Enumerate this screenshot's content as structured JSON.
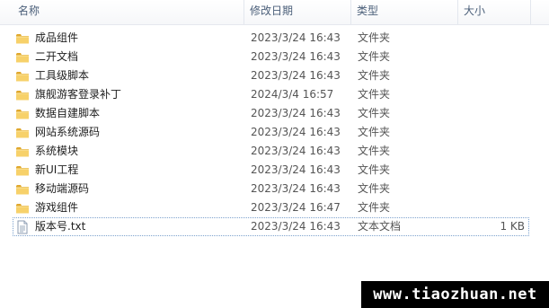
{
  "columns": {
    "name": "名称",
    "modified": "修改日期",
    "type": "类型",
    "size": "大小",
    "sort_indicator": "^"
  },
  "files": [
    {
      "name": "成品组件",
      "modified": "2023/3/24 16:43",
      "type": "文件夹",
      "size": "",
      "icon": "folder-icon"
    },
    {
      "name": "二开文档",
      "modified": "2023/3/24 16:43",
      "type": "文件夹",
      "size": "",
      "icon": "folder-icon"
    },
    {
      "name": "工具级脚本",
      "modified": "2023/3/24 16:43",
      "type": "文件夹",
      "size": "",
      "icon": "folder-icon"
    },
    {
      "name": "旗舰游客登录补丁",
      "modified": "2024/3/4 16:57",
      "type": "文件夹",
      "size": "",
      "icon": "folder-icon"
    },
    {
      "name": "数据自建脚本",
      "modified": "2023/3/24 16:43",
      "type": "文件夹",
      "size": "",
      "icon": "folder-icon"
    },
    {
      "name": "网站系统源码",
      "modified": "2023/3/24 16:43",
      "type": "文件夹",
      "size": "",
      "icon": "folder-icon"
    },
    {
      "name": "系统模块",
      "modified": "2023/3/24 16:43",
      "type": "文件夹",
      "size": "",
      "icon": "folder-icon"
    },
    {
      "name": "新UI工程",
      "modified": "2023/3/24 16:43",
      "type": "文件夹",
      "size": "",
      "icon": "folder-icon"
    },
    {
      "name": "移动端源码",
      "modified": "2023/3/24 16:43",
      "type": "文件夹",
      "size": "",
      "icon": "folder-icon"
    },
    {
      "name": "游戏组件",
      "modified": "2023/3/24 16:47",
      "type": "文件夹",
      "size": "",
      "icon": "folder-icon"
    },
    {
      "name": "版本号.txt",
      "modified": "2023/3/24 16:43",
      "type": "文本文档",
      "size": "1 KB",
      "icon": "text-file-icon"
    }
  ],
  "watermark": "www.tiaozhuan.net",
  "colors": {
    "header_text": "#4c607a",
    "folder_yellow": "#f0c64e",
    "focus_border": "#7da2ce"
  }
}
